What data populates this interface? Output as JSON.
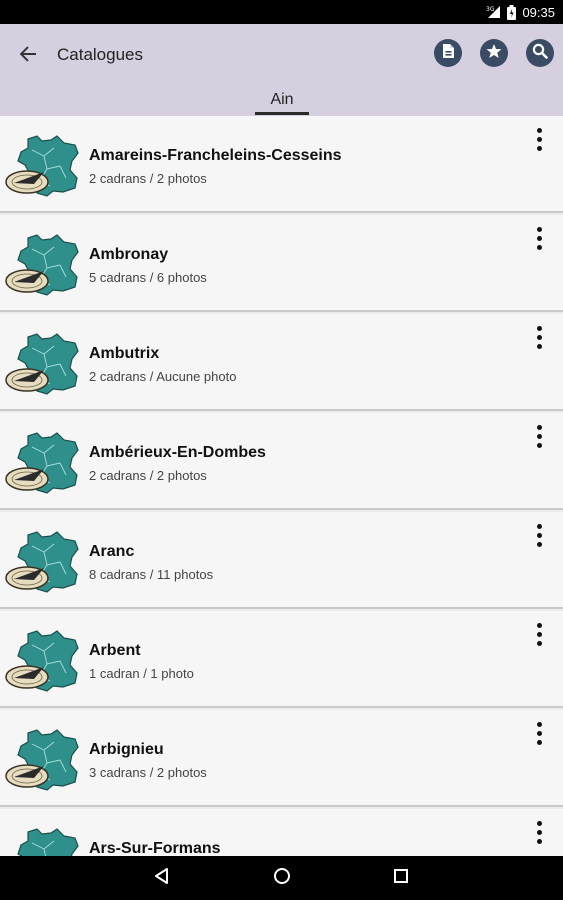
{
  "status_bar": {
    "time": "09:35",
    "network": "3G"
  },
  "app_bar": {
    "title": "Catalogues",
    "tab": "Ain",
    "icons": [
      "arrow-back-icon",
      "pdf-document-icon",
      "star-icon",
      "search-icon"
    ]
  },
  "items": [
    {
      "title": "Amareins-Francheleins-Cesseins",
      "subtitle": "2 cadrans / 2 photos"
    },
    {
      "title": "Ambronay",
      "subtitle": "5 cadrans / 6 photos"
    },
    {
      "title": "Ambutrix",
      "subtitle": "2 cadrans / Aucune photo"
    },
    {
      "title": "Ambérieux-En-Dombes",
      "subtitle": "2 cadrans / 2 photos"
    },
    {
      "title": "Aranc",
      "subtitle": "8 cadrans / 11 photos"
    },
    {
      "title": "Arbent",
      "subtitle": "1 cadran / 1 photo"
    },
    {
      "title": "Arbignieu",
      "subtitle": "3 cadrans / 2 photos"
    },
    {
      "title": "Ars-Sur-Formans",
      "subtitle": ""
    }
  ],
  "colors": {
    "app_bar": "#d6cfe0",
    "action_icon": "#3a4b64",
    "map_teal": "#2f8f8a"
  },
  "nav_bar": {
    "icons": [
      "nav-back-icon",
      "nav-home-icon",
      "nav-recents-icon"
    ]
  }
}
